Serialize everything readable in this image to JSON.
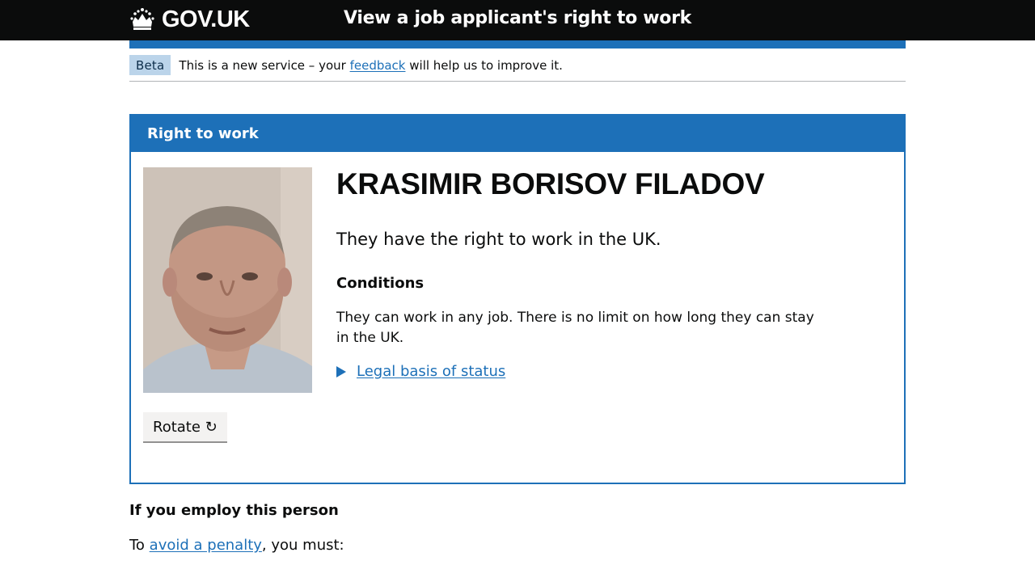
{
  "header": {
    "logo_text": "GOV.UK",
    "service_name": "View a job applicant's right to work"
  },
  "phase": {
    "tag": "Beta",
    "text_before": "This is a new service – your ",
    "link": "feedback",
    "text_after": " will help us to improve it."
  },
  "panel": {
    "heading": "Right to work",
    "name": "KRASIMIR BORISOV FILADOV",
    "status": "They have the right to work in the UK.",
    "conditions_title": "Conditions",
    "conditions_text": "They can work in any job. There is no limit on how long they can stay in the UK.",
    "legal_link": "Legal basis of status",
    "rotate_label": "Rotate ↻"
  },
  "employ": {
    "title": "If you employ this person",
    "text_before": "To ",
    "link": "avoid a penalty",
    "text_after": ", you must:"
  },
  "colors": {
    "brand_blue": "#1d70b8",
    "header_black": "#0b0c0c",
    "beta_tag": "#bbd4ea"
  }
}
